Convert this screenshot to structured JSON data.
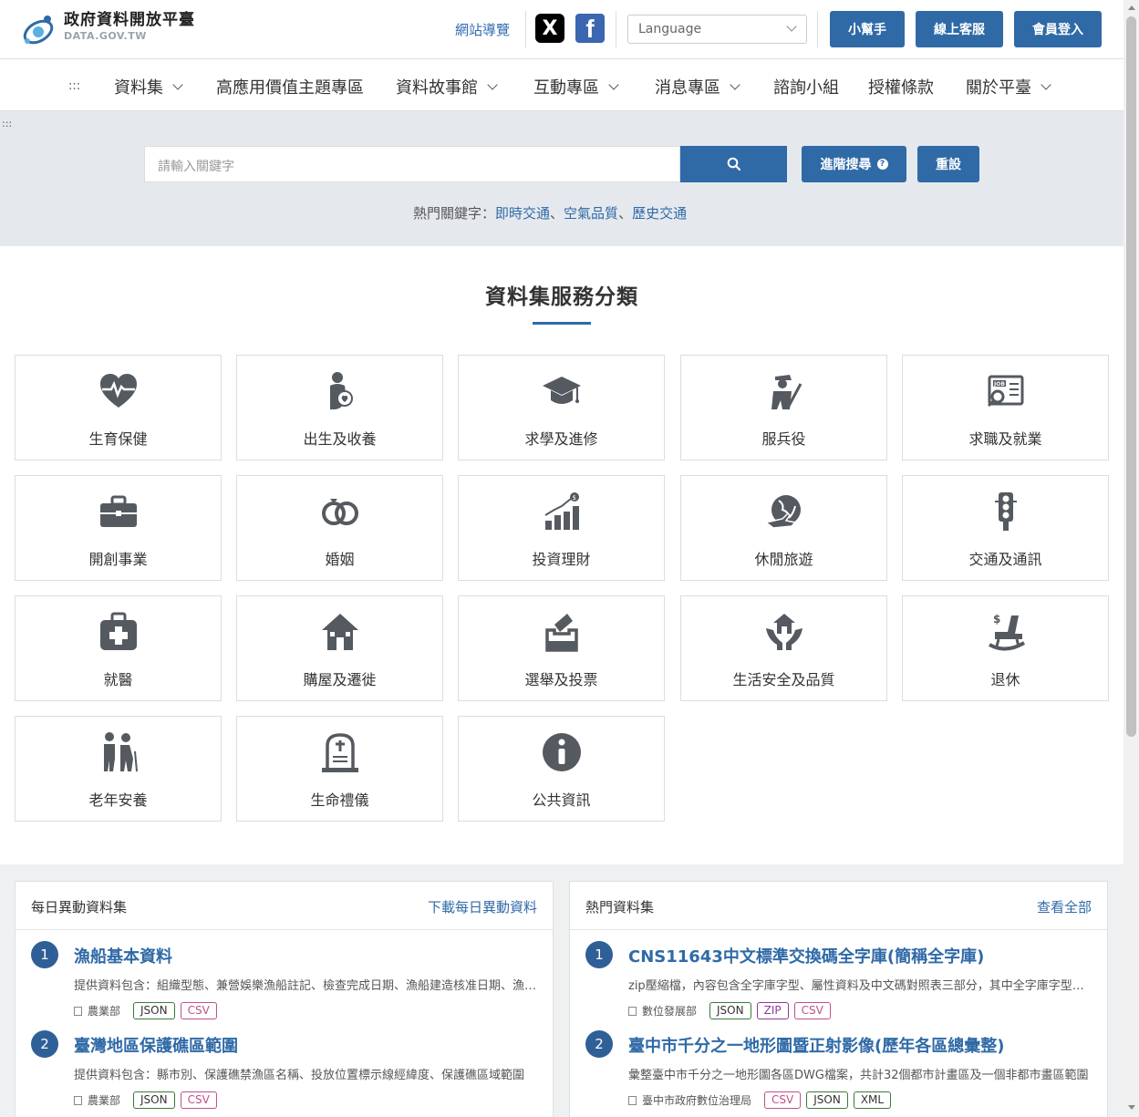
{
  "header": {
    "logo_title": "政府資料開放平臺",
    "logo_sub": "DATA.GOV.TW",
    "site_map": "網站導覽",
    "social_x": "X",
    "social_fb": "f",
    "language_placeholder": "Language",
    "helper": "小幫手",
    "support": "線上客服",
    "login": "會員登入"
  },
  "nav": {
    "dots": ":::",
    "items": [
      {
        "label": "資料集",
        "dropdown": true
      },
      {
        "label": "高應用價值主題專區",
        "dropdown": false
      },
      {
        "label": "資料故事館",
        "dropdown": true
      },
      {
        "label": "互動專區",
        "dropdown": true
      },
      {
        "label": "消息專區",
        "dropdown": true
      },
      {
        "label": "諮詢小組",
        "dropdown": false
      },
      {
        "label": "授權條款",
        "dropdown": false
      },
      {
        "label": "關於平臺",
        "dropdown": true
      }
    ]
  },
  "search": {
    "corner_dots": ":::",
    "placeholder": "請輸入關鍵字",
    "advanced": "進階搜尋",
    "advanced_help": "?",
    "reset": "重設",
    "hot_label": "熱門關鍵字：",
    "hot_keywords": [
      "即時交通",
      "空氣品質",
      "歷史交通"
    ],
    "separator": "、"
  },
  "categories": {
    "title": "資料集服務分類",
    "items": [
      {
        "label": "生育保健",
        "icon": "heart-pulse-icon"
      },
      {
        "label": "出生及收養",
        "icon": "parent-baby-icon"
      },
      {
        "label": "求學及進修",
        "icon": "graduation-cap-icon"
      },
      {
        "label": "服兵役",
        "icon": "soldier-icon"
      },
      {
        "label": "求職及就業",
        "icon": "job-search-icon"
      },
      {
        "label": "開創事業",
        "icon": "briefcase-icon"
      },
      {
        "label": "婚姻",
        "icon": "rings-icon"
      },
      {
        "label": "投資理財",
        "icon": "growth-chart-icon"
      },
      {
        "label": "休閒旅遊",
        "icon": "globe-plane-icon"
      },
      {
        "label": "交通及通訊",
        "icon": "traffic-light-icon"
      },
      {
        "label": "就醫",
        "icon": "medical-kit-icon"
      },
      {
        "label": "購屋及遷徙",
        "icon": "house-icon"
      },
      {
        "label": "選舉及投票",
        "icon": "ballot-box-icon"
      },
      {
        "label": "生活安全及品質",
        "icon": "safe-home-hands-icon"
      },
      {
        "label": "退休",
        "icon": "rocking-chair-icon"
      },
      {
        "label": "老年安養",
        "icon": "elderly-icon"
      },
      {
        "label": "生命禮儀",
        "icon": "tombstone-icon"
      },
      {
        "label": "公共資訊",
        "icon": "info-icon"
      }
    ]
  },
  "daily_panel": {
    "title": "每日異動資料集",
    "link": "下載每日異動資料",
    "items": [
      {
        "num": "1",
        "title": "漁船基本資料",
        "desc": "提供資料包含：組織型態、兼營娛樂漁船註記、檢查完成日期、漁船建造核准日期、漁船總噸位",
        "org": "農業部",
        "tags": [
          "JSON",
          "CSV"
        ]
      },
      {
        "num": "2",
        "title": "臺灣地區保護礁區範圍",
        "desc": "提供資料包含：縣市別、保護礁禁漁區名稱、投放位置標示線經緯度、保護礁區域範圍",
        "org": "農業部",
        "tags": [
          "JSON",
          "CSV"
        ]
      }
    ]
  },
  "hot_panel": {
    "title": "熱門資料集",
    "link": "查看全部",
    "items": [
      {
        "num": "1",
        "title": "CNS11643中文標準交換碼全字庫(簡稱全字庫)",
        "desc": "zip壓縮檔，內容包含全字庫字型、屬性資料及中文碼對照表三部分，其中全字庫字型檔案",
        "org": "數位發展部",
        "tags": [
          "JSON",
          "ZIP",
          "CSV"
        ]
      },
      {
        "num": "2",
        "title": "臺中市千分之一地形圖暨正射影像(歷年各區總彙整)",
        "desc": "彙整臺中市千分之一地形圖各區DWG檔案，共計32個都市計畫區及一個非都市畫區範圍",
        "org": "臺中市政府數位治理局",
        "tags": [
          "CSV",
          "JSON",
          "XML"
        ]
      }
    ]
  },
  "colors": {
    "primary": "#2f6aa7",
    "icon_gray": "#555a60",
    "search_bg": "#e5e9ee"
  }
}
